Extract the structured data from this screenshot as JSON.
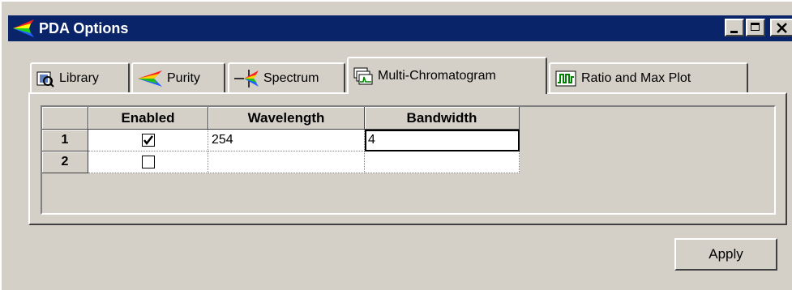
{
  "window": {
    "title": "PDA Options"
  },
  "titlebar_buttons": {
    "minimize": "minimize-button",
    "maximize": "maximize-button",
    "close": "close-button"
  },
  "tabs": [
    {
      "label": "Library",
      "icon": "library-icon",
      "active": false
    },
    {
      "label": "Purity",
      "icon": "purity-icon",
      "active": false
    },
    {
      "label": "Spectrum",
      "icon": "spectrum-icon",
      "active": false
    },
    {
      "label": "Multi-Chromatogram",
      "icon": "multi-chromatogram-icon",
      "active": true
    },
    {
      "label": "Ratio and Max Plot",
      "icon": "ratio-plot-icon",
      "active": false
    }
  ],
  "grid": {
    "columns": [
      "Enabled",
      "Wavelength",
      "Bandwidth"
    ],
    "rows": [
      {
        "index": "1",
        "enabled": true,
        "wavelength": "254",
        "bandwidth": "4"
      },
      {
        "index": "2",
        "enabled": false,
        "wavelength": "",
        "bandwidth": ""
      }
    ]
  },
  "buttons": {
    "apply": "Apply"
  },
  "colors": {
    "titlebar": "#0a246a",
    "face": "#d4d0c8"
  }
}
